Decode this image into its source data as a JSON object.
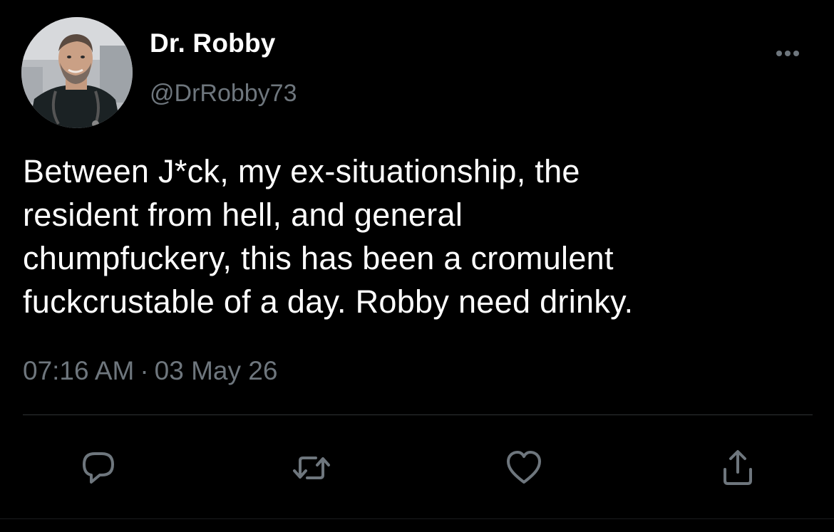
{
  "author": {
    "display_name": "Dr. Robby",
    "handle": "@DrRobby73",
    "avatar_icon": "profile-photo"
  },
  "tweet": {
    "text_lines": [
      "Between J*ck, my ex-situationship, the",
      "resident from hell, and general",
      "chumpfuckery, this has been a cromulent",
      "fuckcrustable of a day. Robby need drinky."
    ],
    "time": "07:16 AM",
    "separator": "·",
    "date": "03 May 26"
  },
  "actions": [
    {
      "name": "reply",
      "icon": "reply-icon"
    },
    {
      "name": "retweet",
      "icon": "retweet-icon"
    },
    {
      "name": "like",
      "icon": "heart-icon"
    },
    {
      "name": "share",
      "icon": "share-icon"
    }
  ],
  "colors": {
    "background": "#000000",
    "text": "#ffffff",
    "secondary": "#6e767d",
    "divider": "#2f3336"
  }
}
